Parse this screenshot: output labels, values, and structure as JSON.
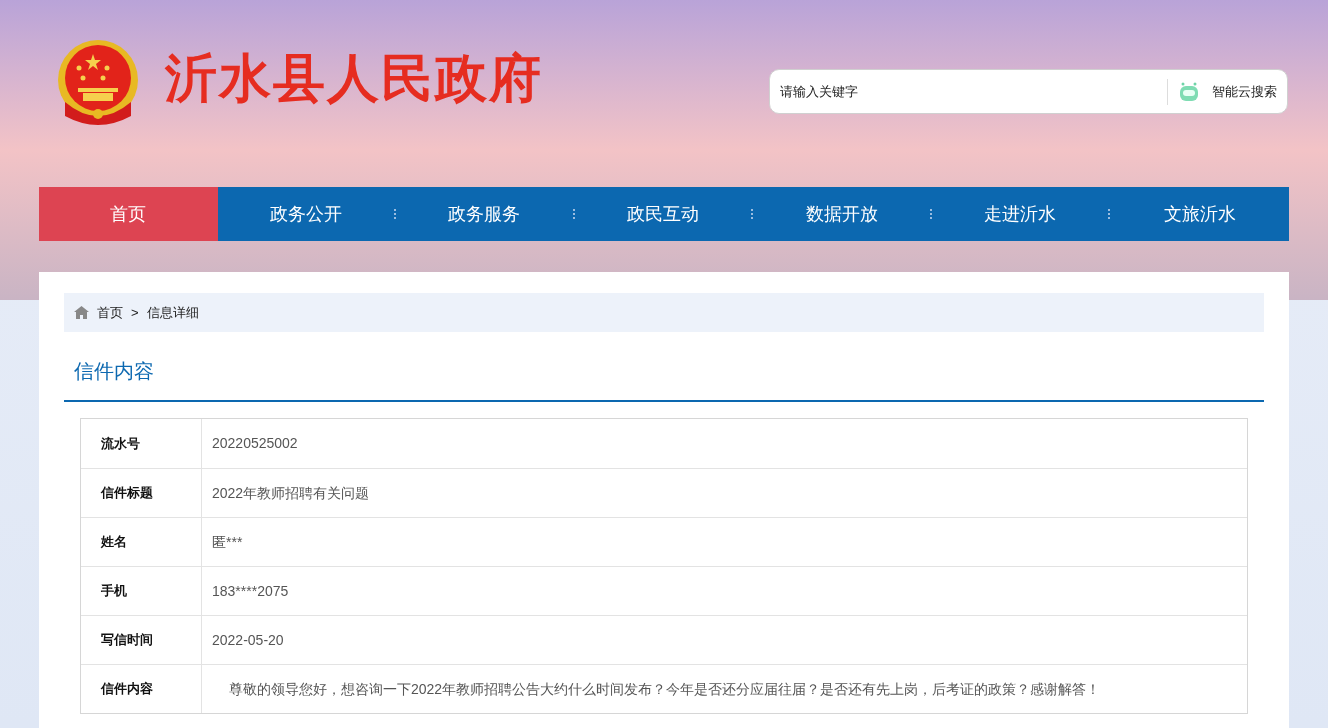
{
  "site_title": "沂水县人民政府",
  "search": {
    "placeholder": "请输入关键字",
    "button": "智能云搜索"
  },
  "nav": [
    {
      "label": "首页",
      "selected": true
    },
    {
      "label": "政务公开",
      "selected": false
    },
    {
      "label": "政务服务",
      "selected": false
    },
    {
      "label": "政民互动",
      "selected": false
    },
    {
      "label": "数据开放",
      "selected": false
    },
    {
      "label": "走进沂水",
      "selected": false
    },
    {
      "label": "文旅沂水",
      "selected": false
    }
  ],
  "breadcrumb": {
    "home": "首页",
    "separator": ">",
    "current": "信息详细"
  },
  "section_title": "信件内容",
  "details": [
    {
      "label": "流水号",
      "value": "20220525002",
      "kind": "plain"
    },
    {
      "label": "信件标题",
      "value": "2022年教师招聘有关问题",
      "kind": "plain"
    },
    {
      "label": "姓名",
      "value": "匿***",
      "kind": "plain"
    },
    {
      "label": "手机",
      "value": "183****2075",
      "kind": "plain"
    },
    {
      "label": "写信时间",
      "value": "2022-05-20",
      "kind": "plain"
    },
    {
      "label": "信件内容",
      "value": "尊敬的领导您好，想咨询一下2022年教师招聘公告大约什么时间发布？今年是否还分应届往届？是否还有先上岗，后考证的政策？感谢解答！",
      "kind": "paragraph"
    }
  ]
}
